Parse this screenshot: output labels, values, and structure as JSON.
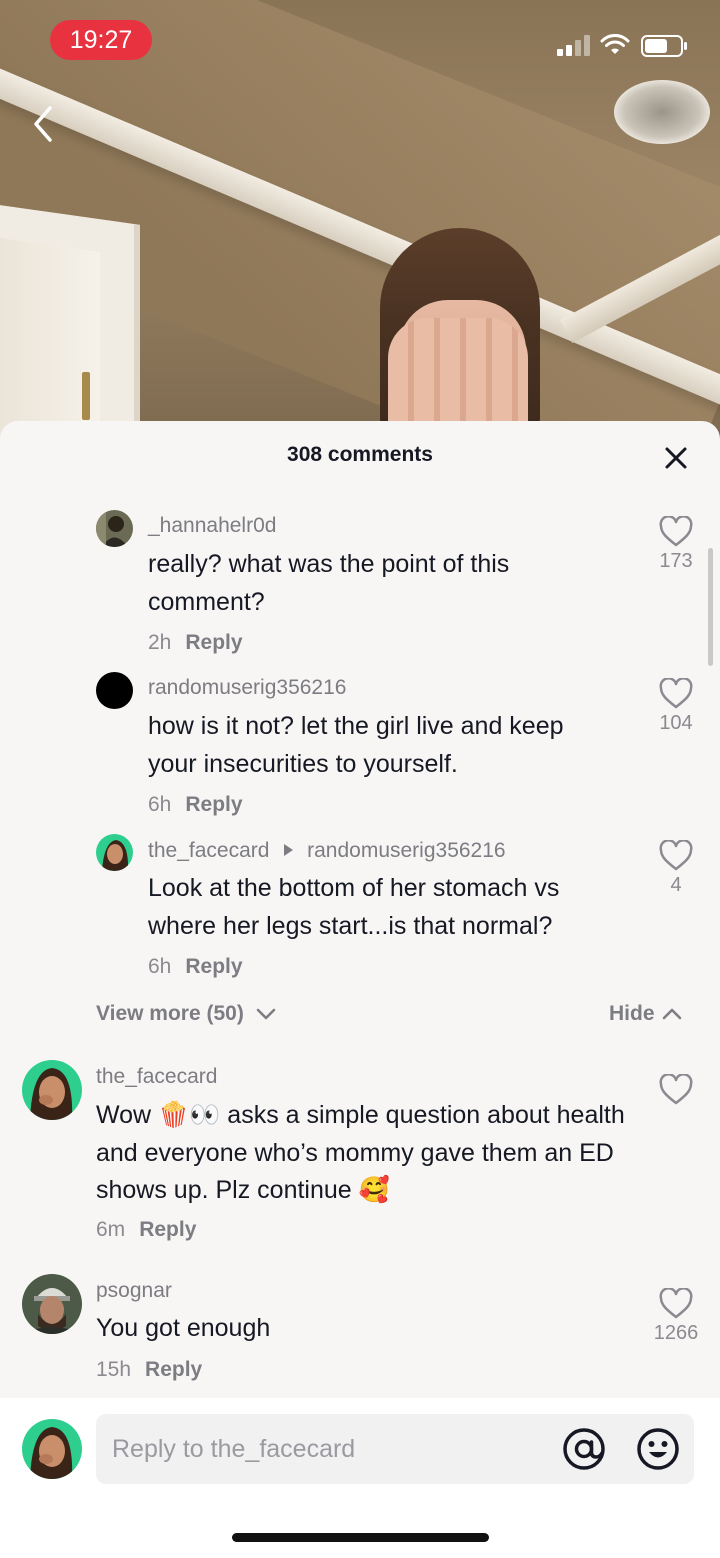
{
  "status_bar": {
    "time": "19:27"
  },
  "sheet": {
    "title": "308 comments"
  },
  "comments": [
    {
      "username": "_hannahelr0d",
      "text": "really? what was the point of this comment?",
      "time": "2h",
      "reply_label": "Reply",
      "likes": "173"
    },
    {
      "username": "randomuserig356216",
      "text": "how is it not? let the girl live and keep your insecurities to yourself.",
      "time": "6h",
      "reply_label": "Reply",
      "likes": "104"
    },
    {
      "username": "the_facecard",
      "reply_to": "randomuserig356216",
      "text": "Look at the bottom of her stomach vs where her legs start...is that normal?",
      "time": "6h",
      "reply_label": "Reply",
      "likes": "4"
    },
    {
      "username": "the_facecard",
      "text_part1": "Wow ",
      "emoji1": "🍿",
      "emoji2": "👀",
      "text_part2": " asks a simple question about health and everyone who’s mommy gave them an ED shows up. Plz continue ",
      "emoji3": "🥰",
      "time": "6m",
      "reply_label": "Reply",
      "likes": ""
    },
    {
      "username": "psognar",
      "text": "You got enough",
      "time": "15h",
      "reply_label": "Reply",
      "likes": "1266"
    }
  ],
  "thread_controls": {
    "view_more": "View more (50)",
    "hide": "Hide"
  },
  "input": {
    "placeholder": "Reply to the_facecard"
  },
  "icons": {
    "back": "chevron-left-icon",
    "close": "close-icon",
    "like": "heart-outline-icon",
    "mention": "at-sign-icon",
    "emoji": "smiley-icon"
  },
  "colors": {
    "status_pill": "#e8323f",
    "sheet_bg": "#f7f6f5",
    "text": "#161823",
    "muted": "#8a8a90"
  }
}
